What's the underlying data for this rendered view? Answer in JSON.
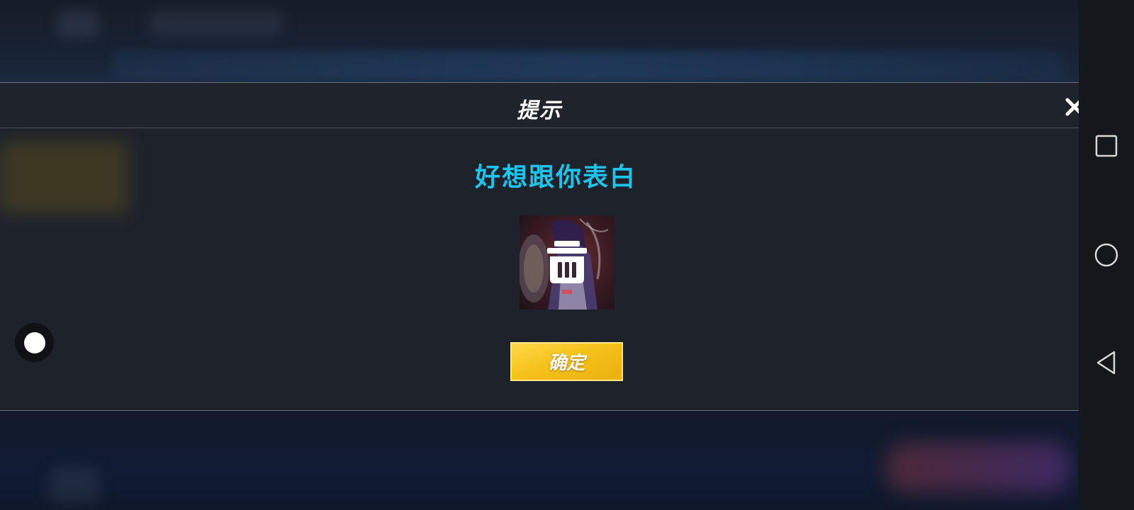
{
  "dialog": {
    "title": "提示",
    "message": "好想跟你表白",
    "confirm_label": "确定"
  },
  "icons": {
    "close": "close-icon",
    "item": "trash-icon",
    "nav_recents": "square-icon",
    "nav_home": "circle-icon",
    "nav_back": "triangle-back-icon"
  },
  "colors": {
    "message": "#1fc3ec",
    "confirm_button": "#f5c21a",
    "dialog_bg": "#1e232b"
  }
}
